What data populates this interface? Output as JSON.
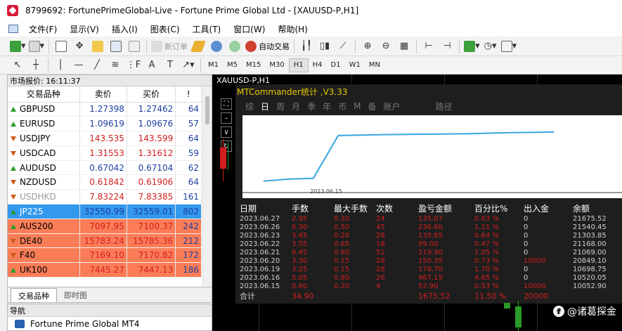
{
  "window": {
    "title": "8799692: FortunePrimeGlobal-Live - Fortune Prime Global Ltd - [XAUUSD-P,H1]"
  },
  "menu": [
    "文件(F)",
    "显示(V)",
    "插入(I)",
    "图表(C)",
    "工具(T)",
    "窗口(W)",
    "帮助(H)"
  ],
  "toolbar": {
    "new_order": "新订单",
    "auto_trade": "自动交易"
  },
  "timeframes": [
    "M1",
    "M5",
    "M15",
    "M30",
    "H1",
    "H4",
    "D1",
    "W1",
    "MN"
  ],
  "active_timeframe": "H1",
  "market_watch": {
    "title": "市场报价: 16:11:37",
    "headers": [
      "交易品种",
      "卖价",
      "买价",
      "!"
    ],
    "rows": [
      {
        "symbol": "GBPUSD",
        "bid": "1.27398",
        "ask": "1.27462",
        "spread": "64",
        "dir": "up",
        "bg": "#ffffff",
        "color": "#1d3ea0"
      },
      {
        "symbol": "EURUSD",
        "bid": "1.09619",
        "ask": "1.09676",
        "spread": "57",
        "dir": "up",
        "bg": "#ffffff",
        "color": "#1d3ea0"
      },
      {
        "symbol": "USDJPY",
        "bid": "143.535",
        "ask": "143.599",
        "spread": "64",
        "dir": "down",
        "bg": "#ffffff",
        "color": "#d21e1e"
      },
      {
        "symbol": "USDCAD",
        "bid": "1.31553",
        "ask": "1.31612",
        "spread": "59",
        "dir": "down",
        "bg": "#ffffff",
        "color": "#d21e1e"
      },
      {
        "symbol": "AUDUSD",
        "bid": "0.67042",
        "ask": "0.67104",
        "spread": "62",
        "dir": "up",
        "bg": "#ffffff",
        "color": "#1d3ea0"
      },
      {
        "symbol": "NZDUSD",
        "bid": "0.61842",
        "ask": "0.61906",
        "spread": "64",
        "dir": "down",
        "bg": "#ffffff",
        "color": "#d21e1e"
      },
      {
        "symbol": "USDHKD",
        "bid": "7.83224",
        "ask": "7.83385",
        "spread": "161",
        "dir": "down",
        "bg": "#ffffff",
        "color": "#d21e1e"
      },
      {
        "symbol": "JP225",
        "bid": "32550.99",
        "ask": "32559.01",
        "spread": "802",
        "dir": "up",
        "bg": "#3399ee",
        "color": "#1d3ea0"
      },
      {
        "symbol": "AUS200",
        "bid": "7097.95",
        "ask": "7100.37",
        "spread": "242",
        "dir": "up",
        "bg": "#fb7d57",
        "color": "#d21e1e"
      },
      {
        "symbol": "DE40",
        "bid": "15783.24",
        "ask": "15785.36",
        "spread": "212",
        "dir": "down",
        "bg": "#fb7d57",
        "color": "#d21e1e"
      },
      {
        "symbol": "F40",
        "bid": "7169.10",
        "ask": "7170.82",
        "spread": "172",
        "dir": "down",
        "bg": "#fb7d57",
        "color": "#d21e1e"
      },
      {
        "symbol": "UK100",
        "bid": "7445.27",
        "ask": "7447.13",
        "spread": "186",
        "dir": "up",
        "bg": "#fb7d57",
        "color": "#d21e1e"
      }
    ],
    "tabs": [
      "交易品种",
      "即时图"
    ]
  },
  "navigator": {
    "title": "导航",
    "item": "Fortune Prime Global MT4"
  },
  "chart": {
    "title": "XAUUSD-P,H1",
    "panel": {
      "title": "MTCommander统计 ,V3.33",
      "tabs": [
        "综",
        "日",
        "周",
        "月",
        "季",
        "年",
        "币",
        "M",
        "备",
        "账户",
        "路径"
      ],
      "active_tab": "日",
      "curve_date": "2023.06.15",
      "columns": [
        "日期",
        "手数",
        "最大手数",
        "次数",
        "盈亏金额",
        "百分比%",
        "出入金",
        "余额"
      ],
      "rows": [
        [
          "2023.06.27",
          "2.95",
          "0.20",
          "24",
          "135.07",
          "0.63 %",
          "0",
          "21675.52"
        ],
        [
          "2023.06.26",
          "6.30",
          "0.50",
          "45",
          "236.60",
          "1.11 %",
          "0",
          "21540.45"
        ],
        [
          "2023.06.23",
          "3.45",
          "0.20",
          "28",
          "135.85",
          "0.64 %",
          "0",
          "21303.85"
        ],
        [
          "2023.06.22",
          "3.55",
          "0.65",
          "18",
          "99.00",
          "0.47 %",
          "0",
          "21168.00"
        ],
        [
          "2023.06.21",
          "6.45",
          "0.60",
          "51",
          "219.90",
          "1.05 %",
          "0",
          "21069.00"
        ],
        [
          "2023.06.20",
          "3.30",
          "0.15",
          "28",
          "150.35",
          "0.73 %",
          "10000",
          "20849.10"
        ],
        [
          "2023.06.19",
          "3.25",
          "0.15",
          "28",
          "178.70",
          "1.70 %",
          "0",
          "10698.75"
        ],
        [
          "2023.06.16",
          "5.05",
          "0.80",
          "26",
          "467.15",
          "4.65 %",
          "0",
          "10520.05"
        ],
        [
          "2023.06.15",
          "0.60",
          "0.20",
          "4",
          "52.90",
          "0.53 %",
          "10000",
          "10052.90"
        ]
      ],
      "total": [
        "合计",
        "34.90",
        "",
        "",
        "1675.52",
        "11.50 %",
        "20000",
        ""
      ]
    },
    "equity_curve": [
      {
        "date": "2023.06.15",
        "balance": 10052.9
      },
      {
        "date": "2023.06.16",
        "balance": 10520.05
      },
      {
        "date": "2023.06.19",
        "balance": 10698.75
      },
      {
        "date": "2023.06.20",
        "balance": 20849.1
      },
      {
        "date": "2023.06.21",
        "balance": 21069.0
      },
      {
        "date": "2023.06.22",
        "balance": 21168.0
      },
      {
        "date": "2023.06.23",
        "balance": 21303.85
      },
      {
        "date": "2023.06.26",
        "balance": 21540.45
      },
      {
        "date": "2023.06.27",
        "balance": 21675.52
      }
    ],
    "watermark": "@诸葛探金"
  },
  "colors": {
    "bull": "#2a9b2a",
    "bear": "#cc5a18",
    "curve": "#37a5e0",
    "positive": "#d21e1e"
  }
}
